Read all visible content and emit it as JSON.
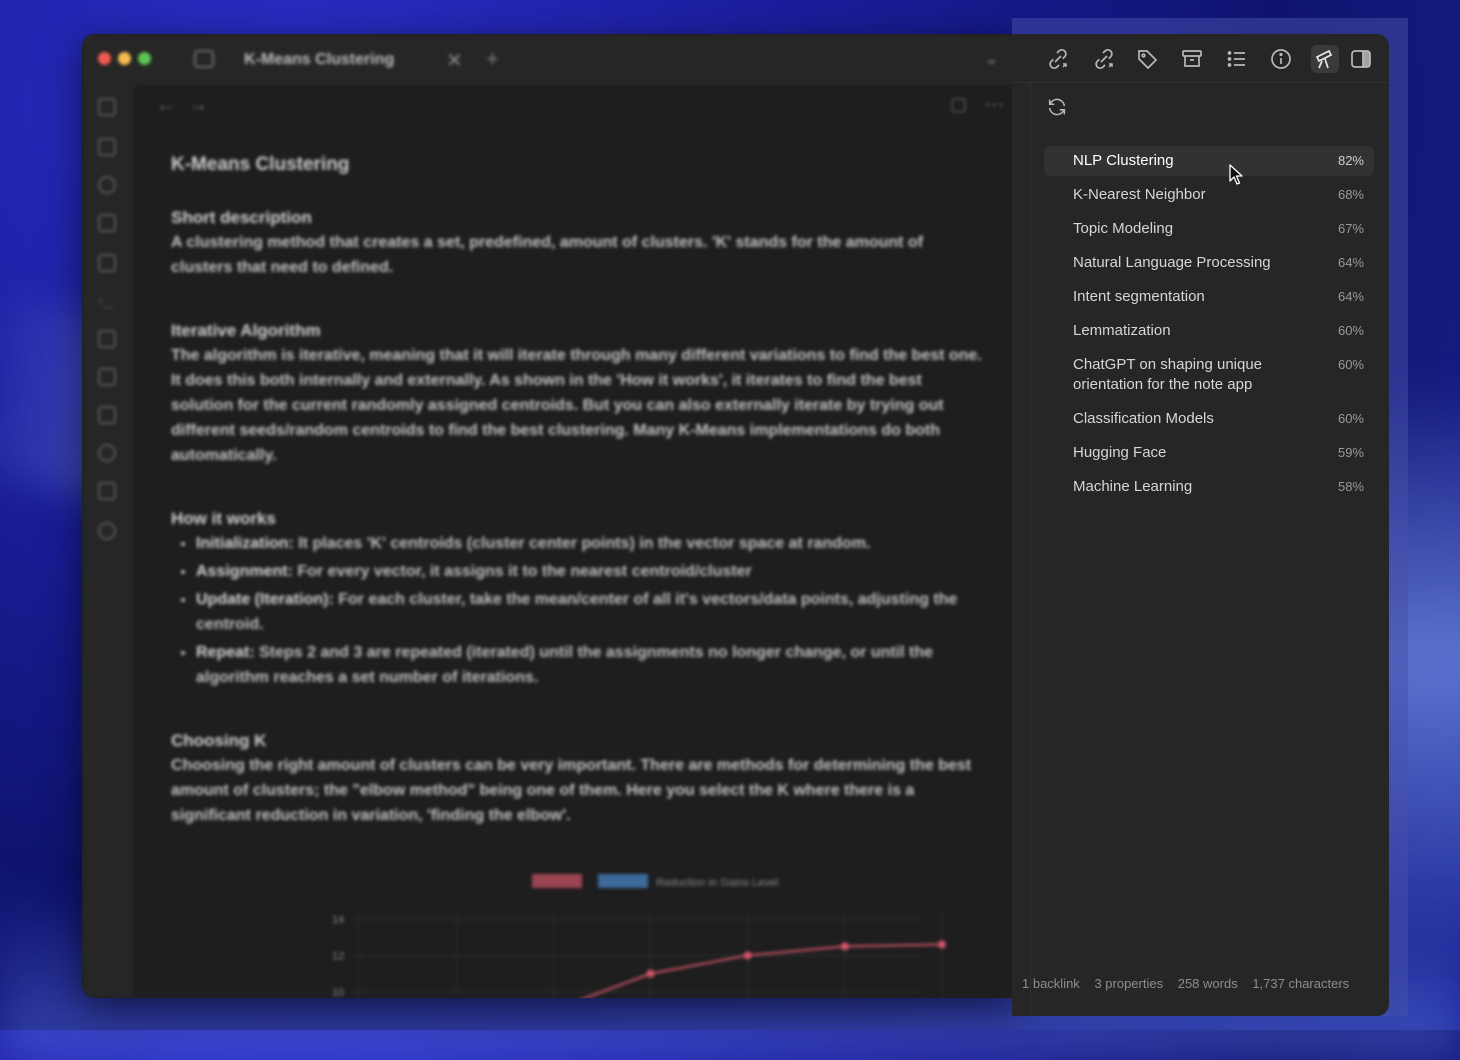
{
  "window": {
    "tab_title": "K-Means Clustering",
    "tab_close_glyph": "✕",
    "new_tab_glyph": "+",
    "tab_dropdown_glyph": "⌄",
    "nav_back_glyph": "←",
    "nav_forward_glyph": "→",
    "reading_glyph": "📖",
    "more_glyph": "⋯"
  },
  "note": {
    "title": "K-Means Clustering",
    "sections": {
      "short_heading": "Short description",
      "short_body": "A clustering method that creates a set, predefined, amount of clusters. 'K' stands for the amount of clusters that need to defined.",
      "iter_heading": "Iterative Algorithm",
      "iter_body": "The algorithm is iterative, meaning that it will iterate through many different variations to find the best one. It does this both internally and externally. As shown in the 'How it works', it iterates to find the best solution for the current randomly assigned centroids. But you can also externally iterate by trying out different seeds/random centroids to find the best clustering. Many K-Means implementations do both automatically.",
      "how_heading": "How it works",
      "steps": [
        {
          "label": "Initialization:",
          "text": " It places 'K' centroids (cluster center points) in the vector space at random."
        },
        {
          "label": "Assignment:",
          "text": " For every vector, it assigns it to the nearest centroid/cluster"
        },
        {
          "label": "Update (Iteration):",
          "text": " For each cluster, take the mean/center of all it's vectors/data points, adjusting the centroid."
        },
        {
          "label": "Repeat:",
          "text": " Steps 2 and 3 are repeated (iterated) until the assignments no longer change, or until the algorithm reaches a set number of iterations."
        }
      ],
      "k_heading": "Choosing K",
      "k_body": "Choosing the right amount of clusters can be very important. There are methods for determining the best amount of clusters; the \"elbow method\" being one of them. Here you select the K where there is a significant reduction in variation, 'finding the elbow'."
    }
  },
  "chart_data": {
    "type": "line",
    "legend": [
      "",
      "Reduction in Gains Level"
    ],
    "y_ticks": [
      "14",
      "12",
      "10"
    ],
    "ylim": [
      9,
      14.5
    ],
    "series": [
      {
        "name": "",
        "color": "#d0566a",
        "values": [
          9,
          9,
          9,
          11,
          12,
          12.5,
          12.6
        ]
      },
      {
        "name": "Reduction in Gains Level",
        "color": "#4a8ad0",
        "values": [
          9,
          9,
          9,
          9,
          9,
          9,
          9
        ]
      }
    ]
  },
  "sidebar": {
    "toolbar_icons": [
      "backlinks-icon",
      "outgoing-links-icon",
      "tags-icon",
      "archive-icon",
      "outline-icon",
      "info-icon",
      "telescope-icon",
      "sidebar-toggle-icon"
    ],
    "refresh_label": "Refresh",
    "related": [
      {
        "title": "NLP Clustering",
        "score": "82%"
      },
      {
        "title": "K-Nearest Neighbor",
        "score": "68%"
      },
      {
        "title": "Topic Modeling",
        "score": "67%"
      },
      {
        "title": "Natural Language Processing",
        "score": "64%"
      },
      {
        "title": "Intent segmentation",
        "score": "64%"
      },
      {
        "title": "Lemmatization",
        "score": "60%"
      },
      {
        "title": "ChatGPT on shaping unique orientation for the note app",
        "score": "60%"
      },
      {
        "title": "Classification Models",
        "score": "60%"
      },
      {
        "title": "Hugging Face",
        "score": "59%"
      },
      {
        "title": "Machine Learning",
        "score": "58%"
      }
    ]
  },
  "status": {
    "backlinks": "1 backlink",
    "properties": "3 properties",
    "words": "258 words",
    "characters": "1,737 characters"
  }
}
